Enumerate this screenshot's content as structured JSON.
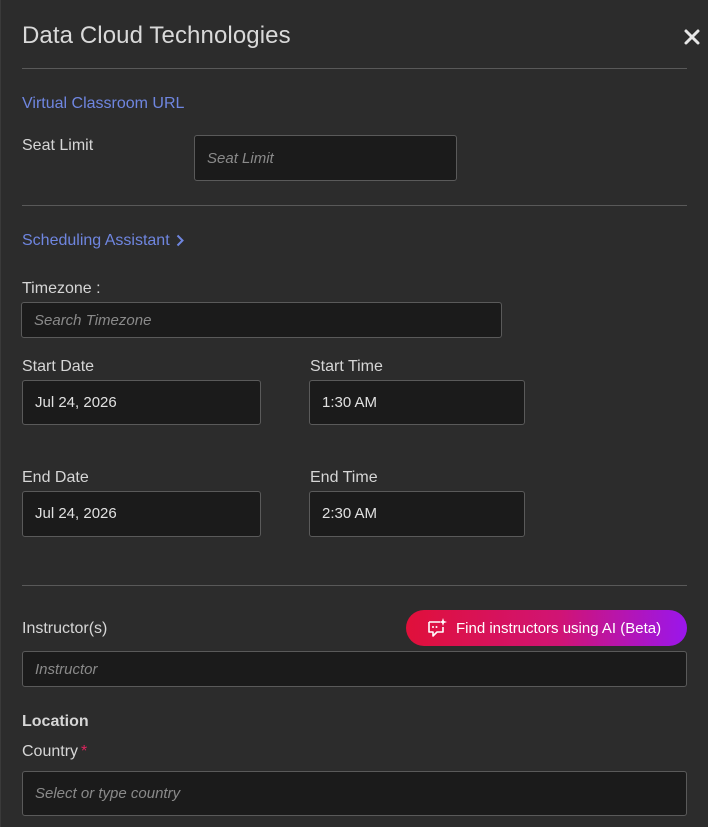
{
  "header": {
    "title": "Data Cloud Technologies",
    "close_icon": "close-icon"
  },
  "virtual_classroom": {
    "link_label": "Virtual Classroom URL"
  },
  "seat_limit": {
    "label": "Seat Limit",
    "placeholder": "Seat Limit"
  },
  "scheduling": {
    "link_label": "Scheduling Assistant"
  },
  "timezone": {
    "label": "Timezone :",
    "placeholder": "Search Timezone"
  },
  "start_date": {
    "label": "Start Date",
    "value": "Jul 24, 2026"
  },
  "start_time": {
    "label": "Start Time",
    "value": "1:30 AM"
  },
  "end_date": {
    "label": "End Date",
    "value": "Jul 24, 2026"
  },
  "end_time": {
    "label": "End Time",
    "value": "2:30 AM"
  },
  "instructors": {
    "label": "Instructor(s)",
    "placeholder": "Instructor",
    "ai_button_label": "Find instructors using AI (Beta)"
  },
  "location": {
    "heading": "Location",
    "country_label": "Country",
    "required_mark": "*",
    "country_placeholder": "Select or type country"
  },
  "colors": {
    "background": "#2c2c2c",
    "link": "#6f86e0",
    "input_bg": "#1b1b1b",
    "ai_gradient_start": "#e0103a",
    "ai_gradient_end": "#9a16ec",
    "required": "#e0245e"
  }
}
